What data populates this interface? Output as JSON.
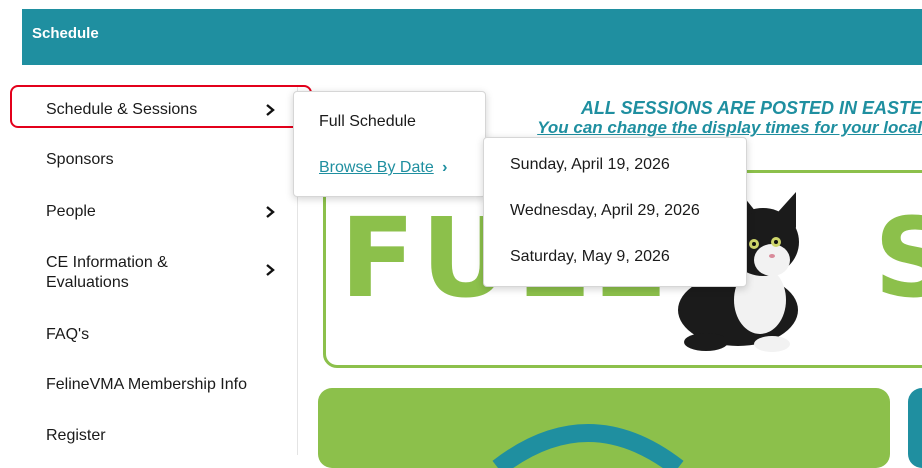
{
  "header": {
    "title": "Schedule"
  },
  "sidebar": {
    "items": [
      {
        "label": "Schedule & Sessions",
        "has_submenu": true
      },
      {
        "label": "Sponsors",
        "has_submenu": false
      },
      {
        "label": "People",
        "has_submenu": true
      },
      {
        "label": "CE Information & Evaluations",
        "line1": "CE Information &",
        "line2": "Evaluations",
        "has_submenu": true
      },
      {
        "label": "FAQ's",
        "has_submenu": false
      },
      {
        "label": "FelineVMA Membership Info",
        "has_submenu": false
      },
      {
        "label": "Register",
        "has_submenu": false
      }
    ]
  },
  "submenu": {
    "items": [
      {
        "label": "Full Schedule"
      },
      {
        "label": "Browse By Date",
        "chevron": "›"
      }
    ]
  },
  "date_menu": {
    "items": [
      {
        "label": "Sunday, April 19, 2026"
      },
      {
        "label": "Wednesday, April 29, 2026"
      },
      {
        "label": "Saturday, May 9, 2026"
      }
    ]
  },
  "main": {
    "banner_line1": "ALL SESSIONS ARE POSTED IN EASTE",
    "banner_line2": "You can change the display times for your local",
    "hero_word_left": "FULL",
    "hero_word_right": "S"
  },
  "colors": {
    "accent": "#1f8fa0",
    "green": "#8cc04b",
    "highlight": "#e3001b"
  }
}
